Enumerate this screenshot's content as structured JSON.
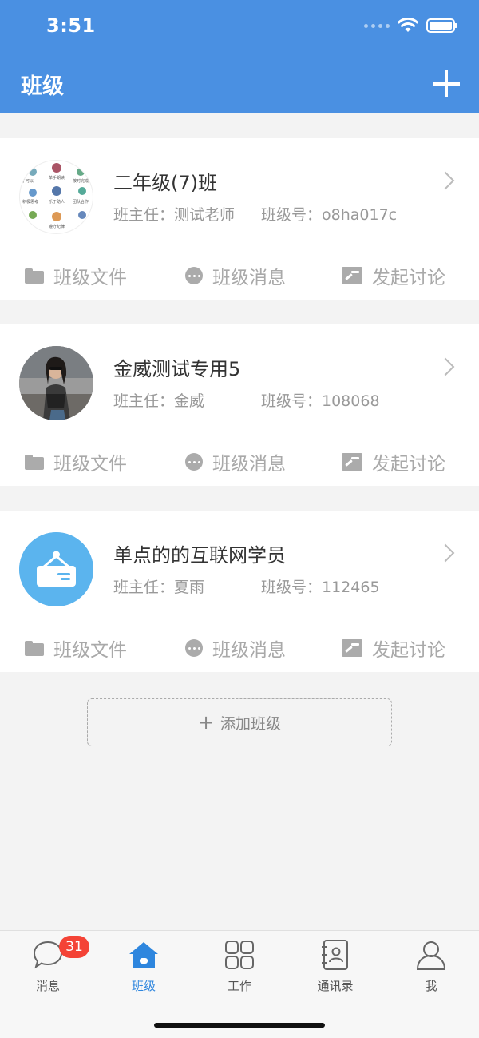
{
  "status_bar": {
    "time": "3:51"
  },
  "header": {
    "title": "班级",
    "add_icon": "plus-icon"
  },
  "classes": [
    {
      "name": "二年级(7)班",
      "teacher": "班主任：测试老师",
      "class_no": "班级号：o8ha017c",
      "avatar": "collage-avatar",
      "avatar_texts": [
        "子可以",
        "单手朗读",
        "按时完成",
        "积极思考",
        "乐于助人",
        "团队合作",
        "遵守纪律"
      ]
    },
    {
      "name": "金威测试专用5",
      "teacher": "班主任：金威",
      "class_no": "班级号：108068",
      "avatar": "photo-avatar"
    },
    {
      "name": "单点的的互联网学员",
      "teacher": "班主任：夏雨",
      "class_no": "班级号：112465",
      "avatar": "sign-avatar",
      "avatar_color": "#5bb4ee"
    }
  ],
  "actions": {
    "files": "班级文件",
    "messages": "班级消息",
    "discussion": "发起讨论"
  },
  "add_class": {
    "label": "添加班级"
  },
  "tabbar": {
    "items": [
      {
        "label": "消息",
        "icon": "chat-bubble-icon",
        "badge": "31"
      },
      {
        "label": "班级",
        "icon": "home-icon",
        "active": true
      },
      {
        "label": "工作",
        "icon": "grid-icon"
      },
      {
        "label": "通讯录",
        "icon": "contacts-book-icon"
      },
      {
        "label": "我",
        "icon": "person-icon"
      }
    ]
  },
  "colors": {
    "primary": "#4a90e2",
    "active_tab": "#2e86de",
    "badge": "#f44336"
  }
}
